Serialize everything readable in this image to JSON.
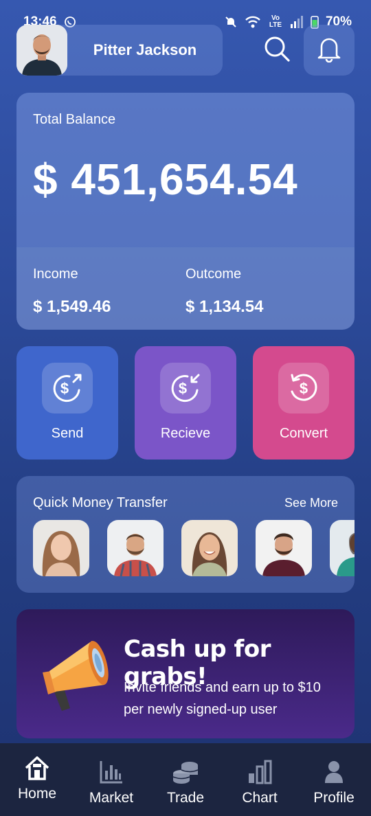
{
  "status_bar": {
    "time": "13:46",
    "battery": "70%",
    "icons": [
      "whatsapp-icon",
      "mute-icon",
      "wifi-icon",
      "volte-icon",
      "signal-icon",
      "battery-icon"
    ],
    "network_label": "Vo LTE"
  },
  "header": {
    "user_name": "Pitter Jackson",
    "icons": [
      "search-icon",
      "bell-icon"
    ]
  },
  "balance": {
    "label": "Total Balance",
    "value": "$ 451,654.54",
    "income_label": "Income",
    "income_value": "$ 1,549.46",
    "outcome_label": "Outcome",
    "outcome_value": "$ 1,134.54"
  },
  "actions": [
    {
      "label": "Send",
      "color": "#3f66cc",
      "icon": "send-money-icon"
    },
    {
      "label": "Recieve",
      "color": "#7b55c8",
      "icon": "receive-money-icon"
    },
    {
      "label": "Convert",
      "color": "#d44a8e",
      "icon": "convert-money-icon"
    }
  ],
  "quick_transfer": {
    "title": "Quick Money Transfer",
    "see_more": "See More"
  },
  "promo": {
    "title": "Cash up for grabs!",
    "text": "Invite friends and earn up to $10 per newly signed-up user",
    "icon": "megaphone-icon"
  },
  "nav": [
    {
      "label": "Home",
      "icon": "home-icon"
    },
    {
      "label": "Market",
      "icon": "market-chart-icon"
    },
    {
      "label": "Trade",
      "icon": "coins-icon"
    },
    {
      "label": "Chart",
      "icon": "bar-chart-icon"
    },
    {
      "label": "Profile",
      "icon": "person-icon"
    }
  ],
  "colors": {
    "background_top": "#3658b0",
    "nav_background": "#1c2540",
    "send": "#3f66cc",
    "receive": "#7b55c8",
    "convert": "#d44a8e",
    "promo": "#4a2a8a"
  }
}
